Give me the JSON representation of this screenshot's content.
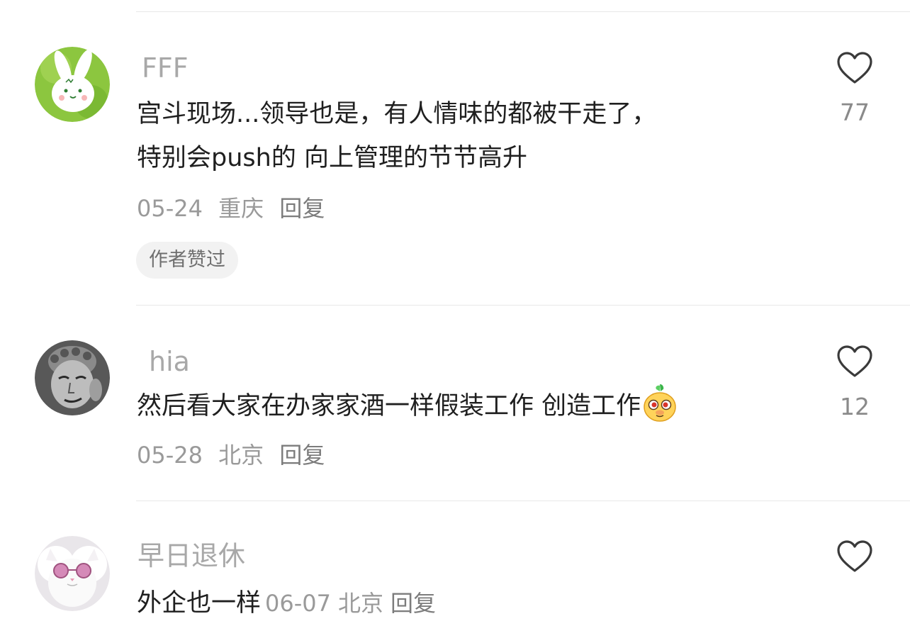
{
  "comments": [
    {
      "username": "FFF",
      "avatar_icon": "green-rabbit-avatar",
      "content_line1": "宫斗现场...领导也是，有人情味的都被干走了，",
      "content_line2": "特别会push的 向上管理的节节高升",
      "date": "05-24",
      "location": "重庆",
      "reply_label": "回复",
      "badge": "作者赞过",
      "likes": "77"
    },
    {
      "username": "hia",
      "avatar_icon": "stone-statue-avatar",
      "content": "然后看大家在办家家酒一样假装工作 创造工作",
      "emoji_icon": "smirk-face-emoji",
      "date": "05-28",
      "location": "北京",
      "reply_label": "回复",
      "likes": "12"
    },
    {
      "username": "早日退休",
      "avatar_icon": "white-cat-sunglasses-avatar",
      "content": "外企也一样",
      "date": "06-07",
      "location": "北京",
      "reply_label": "回复"
    }
  ],
  "like_icon": "heart-outline-icon",
  "colors": {
    "text": "#1f1f1f",
    "username": "#a8a8a8",
    "meta": "#9a9a9a",
    "badge_bg": "#f2f2f2",
    "divider": "#e8e8e8"
  }
}
